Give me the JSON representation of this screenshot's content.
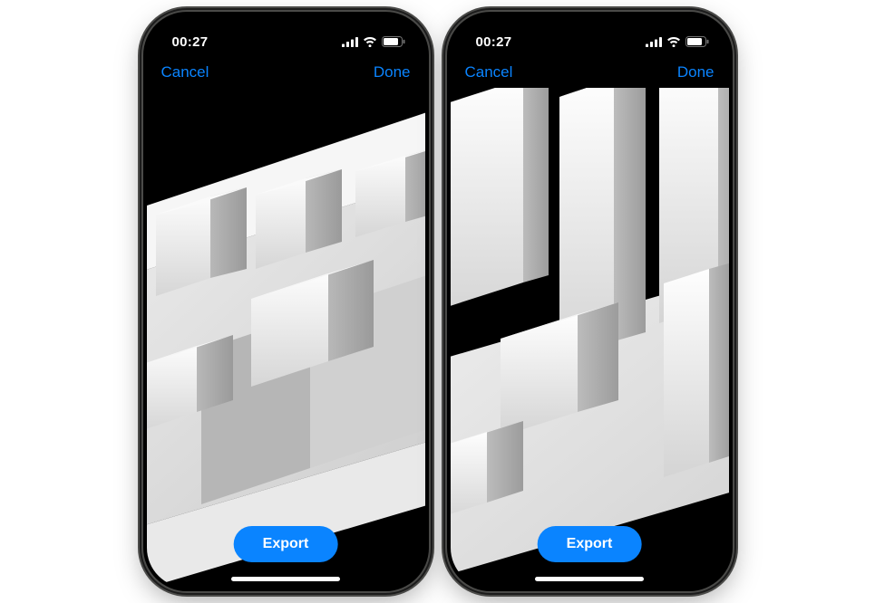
{
  "phones": [
    {
      "status": {
        "time": "00:27"
      },
      "nav": {
        "cancel": "Cancel",
        "done": "Done"
      },
      "action": {
        "export": "Export"
      }
    },
    {
      "status": {
        "time": "00:27"
      },
      "nav": {
        "cancel": "Cancel",
        "done": "Done"
      },
      "action": {
        "export": "Export"
      }
    }
  ],
  "colors": {
    "accent": "#0a84ff"
  }
}
